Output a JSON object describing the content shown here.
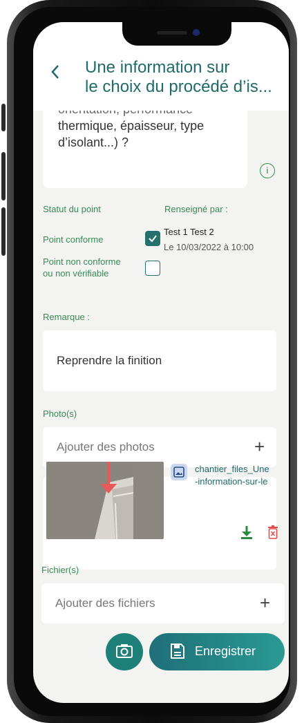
{
  "header": {
    "back_icon": "chevron-left-icon",
    "title_line1": "Une information sur",
    "title_line2": "le choix du procédé d’is..."
  },
  "question": {
    "line1": "orientation, performance",
    "line2": "thermique, épaisseur, type",
    "line3": "d’isolant...) ?",
    "info_icon": "info-icon"
  },
  "status": {
    "title": "Statut du point",
    "filled_by_label": "Renseigné par :",
    "conforme_label": "Point conforme",
    "conforme_checked": true,
    "non_conforme_label_1": "Point non conforme",
    "non_conforme_label_2": "ou non vérifiable",
    "non_conforme_checked": false,
    "filled_by_name": "Test 1 Test 2",
    "filled_date": "Le 10/03/2022 à 10:00"
  },
  "remark": {
    "label": "Remarque :",
    "value": "Reprendre la finition"
  },
  "photos": {
    "label": "Photo(s)",
    "add_label": "Ajouter des photos",
    "add_icon": "plus-icon",
    "file_name_1": "chantier_files_Une",
    "file_name_2": "-information-sur-le",
    "download_icon": "download-icon",
    "delete_icon": "trash-icon"
  },
  "files": {
    "label": "Fichier(s)",
    "add_label": "Ajouter des fichiers",
    "add_icon": "plus-icon"
  },
  "actions": {
    "camera_icon": "camera-icon",
    "save_label": "Enregistrer",
    "save_icon": "save-icon"
  },
  "colors": {
    "accent": "#1f6b69",
    "green_label": "#3a8a56",
    "delete": "#e04a4a",
    "background": "#f3f3f2"
  }
}
